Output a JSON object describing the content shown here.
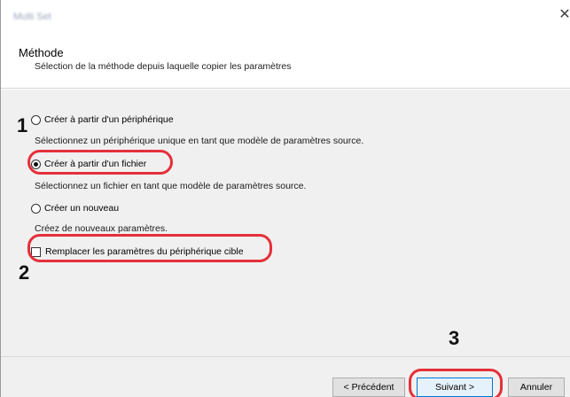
{
  "window": {
    "title": "Multi Set",
    "close_glyph": "✕"
  },
  "header": {
    "title": "Méthode",
    "subtitle": "Sélection de la méthode depuis laquelle copier les paramètres"
  },
  "options": [
    {
      "label": "Créer à partir d'un périphérique",
      "description": "Sélectionnez un périphérique unique en tant que modèle de paramètres source.",
      "checked": false
    },
    {
      "label": "Créer à partir d'un fichier",
      "description": "Sélectionnez un fichier en tant que modèle de paramètres source.",
      "checked": true
    },
    {
      "label": "Créer un nouveau",
      "description": "Créez de nouveaux paramètres.",
      "checked": false
    }
  ],
  "replace_checkbox": {
    "label": "Remplacer les paramètres du périphérique cible",
    "checked": false
  },
  "steps": [
    "1",
    "2",
    "3"
  ],
  "buttons": {
    "previous": "< Précédent",
    "next": "Suivant >",
    "cancel": "Annuler"
  },
  "colors": {
    "callout": "#e5303a",
    "primary_border": "#0078d7"
  }
}
